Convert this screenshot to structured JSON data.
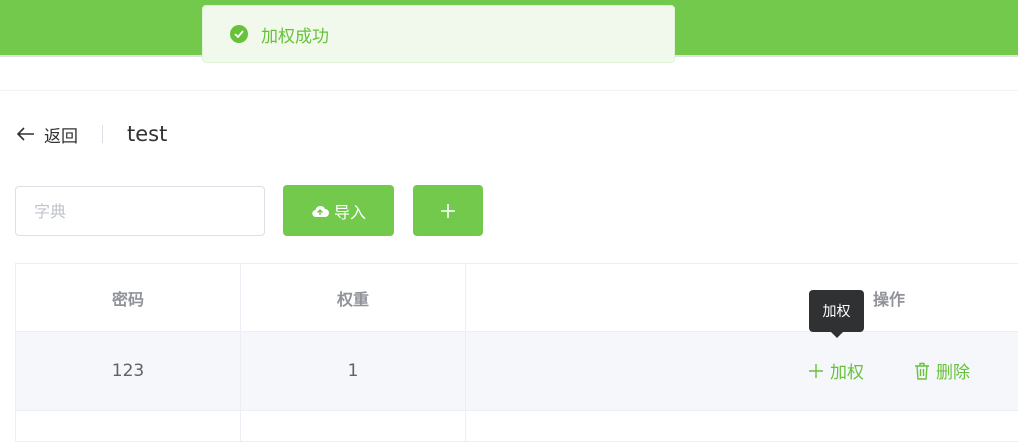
{
  "toast": {
    "message": "加权成功",
    "icon": "check-circle-icon"
  },
  "header": {
    "back_label": "返回",
    "title": "test"
  },
  "toolbar": {
    "search_placeholder": "字典",
    "import_label": "导入",
    "add_label": "+"
  },
  "table": {
    "columns": [
      "密码",
      "权重",
      "操作"
    ],
    "rows": [
      {
        "password": "123",
        "weight": "1",
        "promote_label": "加权",
        "delete_label": "删除"
      }
    ]
  },
  "tooltip": {
    "text": "加权"
  },
  "colors": {
    "brand_green": "#73c94b",
    "success_text": "#67c23a",
    "tooltip_bg": "#303133"
  }
}
